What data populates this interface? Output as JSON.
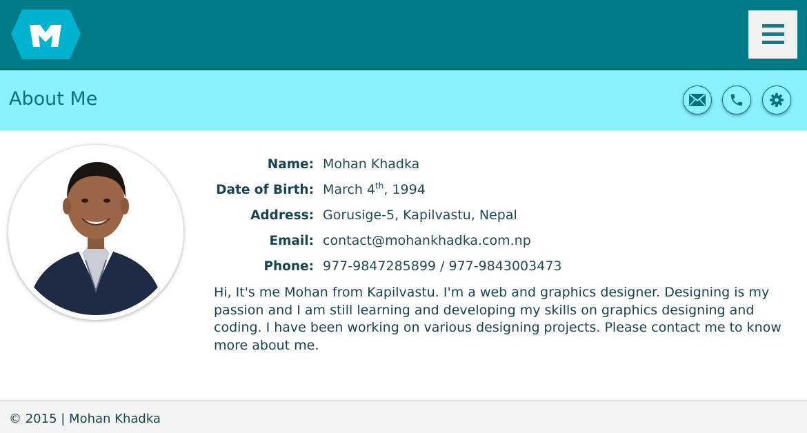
{
  "header": {
    "logo_letter": "M",
    "menu_label": "menu"
  },
  "subheader": {
    "title": "About Me",
    "actions": [
      {
        "icon": "envelope-icon"
      },
      {
        "icon": "phone-icon"
      },
      {
        "icon": "gear-icon"
      }
    ]
  },
  "profile": {
    "fields": [
      {
        "label": "Name:",
        "value": "Mohan Khadka"
      },
      {
        "label": "Date of Birth:",
        "value": "March 4",
        "value_sup": "th",
        "value_tail": ", 1994"
      },
      {
        "label": "Address:",
        "value": "Gorusige-5, Kapilvastu, Nepal"
      },
      {
        "label": "Email:",
        "value": "contact@mohankhadka.com.np"
      },
      {
        "label": "Phone:",
        "value": "977-9847285899 / 977-9843003473"
      }
    ],
    "bio": "Hi, It's me Mohan from Kapilvastu. I'm a web and graphics designer. Designing is my passion and I am still learning and developing my skills on graphics designing and coding. I have been working on various designing projects. Please contact me to know more about me."
  },
  "footer": {
    "copyright": "© 2015 | Mohan Khadka"
  },
  "colors": {
    "topbar": "#007a87",
    "subheader": "#89f1ff",
    "title": "#0c6f7c",
    "text": "#17424f",
    "logo": "#00b2ce"
  }
}
